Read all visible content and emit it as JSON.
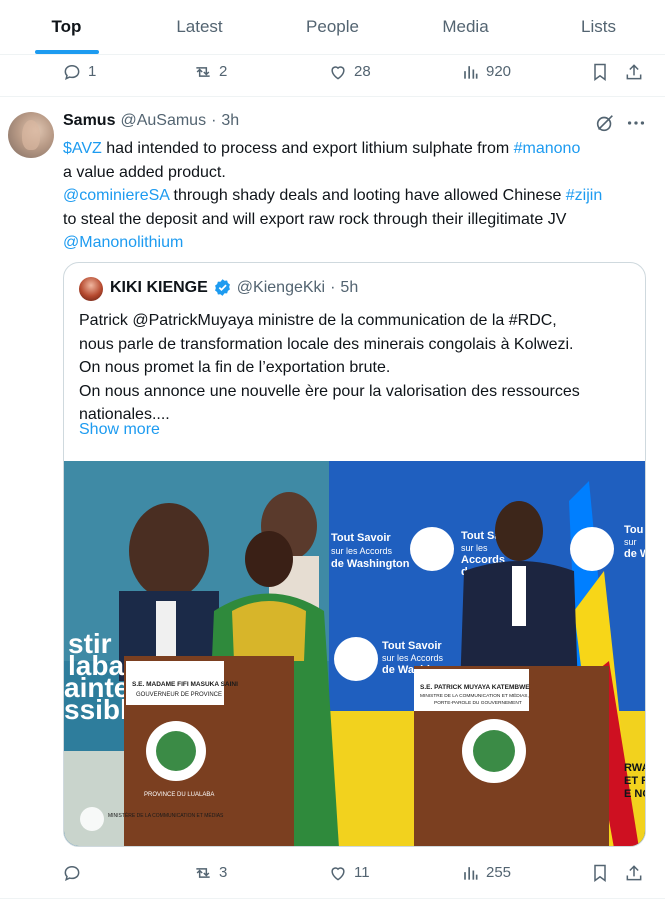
{
  "tabs": [
    {
      "label": "Top",
      "active": true
    },
    {
      "label": "Latest",
      "active": false
    },
    {
      "label": "People",
      "active": false
    },
    {
      "label": "Media",
      "active": false
    },
    {
      "label": "Lists",
      "active": false
    }
  ],
  "prev_tweet": {
    "replies": "1",
    "reposts": "2",
    "likes": "28",
    "views": "920"
  },
  "tweet": {
    "name": "Samus",
    "handle": "@AuSamus",
    "sep": "·",
    "time": "3h",
    "text": {
      "l1_cashtag": "$AVZ",
      "l1_text": " had intended to process and export lithium sulphate from ",
      "l1_hashtag": "#manono",
      "l2_text": "a value added product.",
      "l3_mention": "@cominiereSA",
      "l3_text": " through shady deals and looting have allowed Chinese ",
      "l3_hashtag": "#zijin",
      "l4_text": "to steal the deposit and will export raw rock through their illegitimate JV",
      "l5_mention": "@Manonolithium"
    },
    "quote": {
      "name": "KIKI KIENGE",
      "handle": "@KiengeKki",
      "sep": "·",
      "time": "5h",
      "lines": [
        "Patrick @PatrickMuyaya ministre de la communication de la #RDC,",
        "nous parle de transformation locale des minerais congolais à Kolwezi.",
        "On nous promet la fin de l’exportation brute.",
        "On nous annonce une nouvelle ère pour la valorisation des ressources",
        "nationales...."
      ],
      "show_more": "Show more",
      "photo": {
        "banner_left": [
          "stir",
          "laba",
          "ainte",
          "ssible"
        ],
        "banner_text_1": [
          "Tout Savoir",
          "sur les Accords",
          "de Washington"
        ],
        "banner_text_2": [
          "Tout Savoir",
          "sur les",
          "Accords",
          "de Washin"
        ],
        "banner_text_3": [
          "Tout Savoir",
          "sur les Accords",
          "de Washin"
        ],
        "banner_text_4": [
          "Tou",
          "sur",
          "de W"
        ],
        "podium_left": [
          "S.E. MADAME FIFI MASUKA SAINI",
          "GOUVERNEUR DE PROVINCE"
        ],
        "podium_right": [
          "S.E. PATRICK MUYAYA KATEMBWE",
          "MINISTRE DE LA COMMUNICATION ET MÉDIAS,",
          "PORTE-PAROLE DU GOUVERNEMENT"
        ],
        "seal_text": "PROVINCE DU LUALABA",
        "ministry_logo": "MINISTÈRE DE LA COMMUNICATION ET MÉDIAS",
        "right_edge": [
          "RWA",
          "ET RÉ",
          "E NOU"
        ]
      }
    },
    "stats": {
      "replies": "",
      "reposts": "3",
      "likes": "11",
      "views": "255"
    }
  },
  "colors": {
    "accent": "#1d9bf0",
    "text": "#0f1419",
    "muted": "#536471",
    "border": "#cfd9de"
  }
}
